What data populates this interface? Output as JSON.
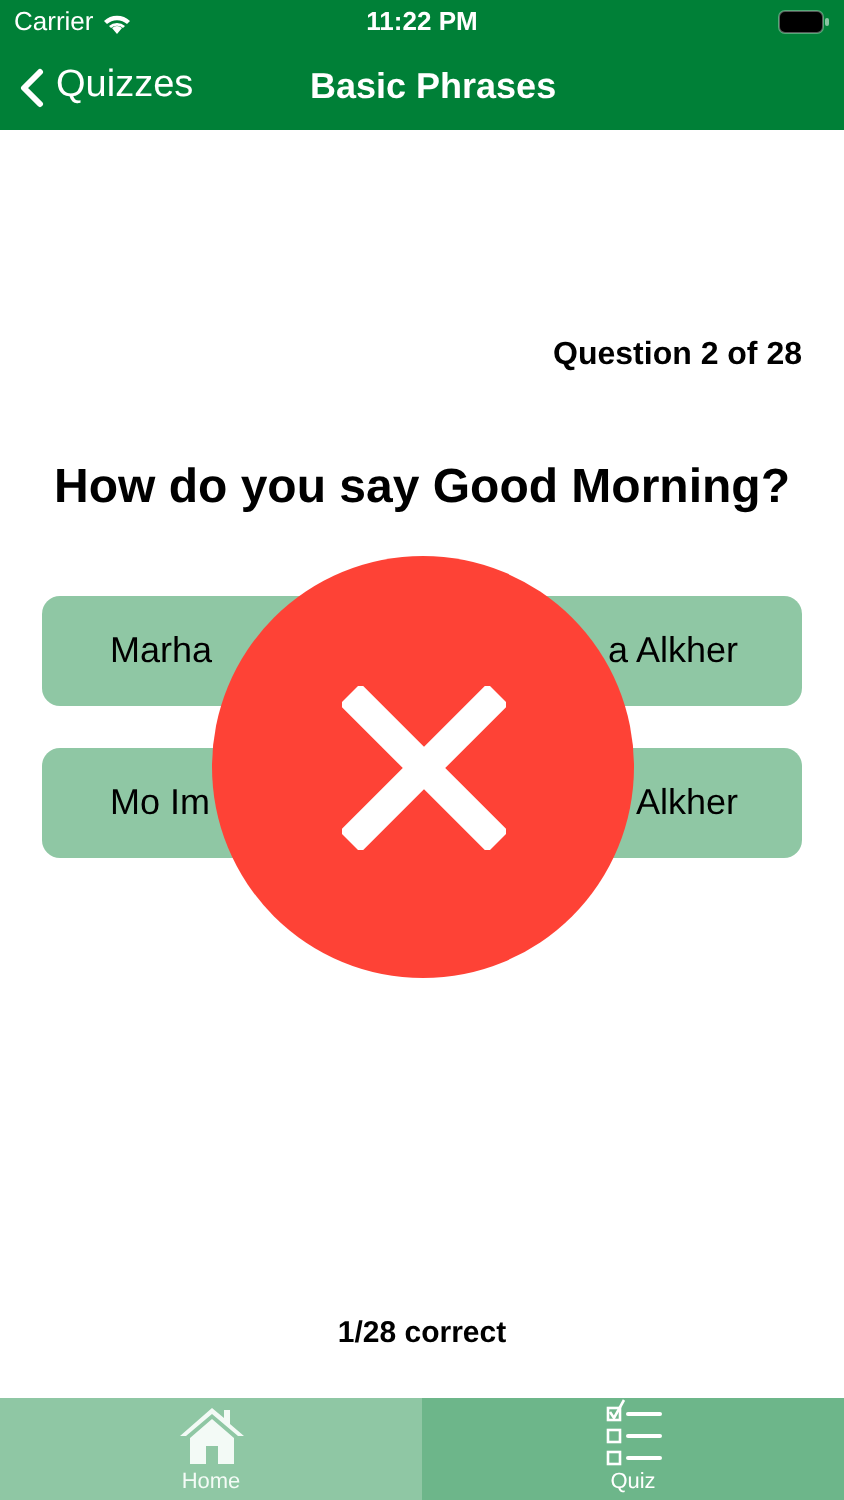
{
  "status_bar": {
    "carrier": "Carrier",
    "time": "11:22 PM"
  },
  "nav_bar": {
    "back": "Quizzes",
    "title": "Basic Phrases"
  },
  "progress": "Question 2 of 28",
  "question": "How do you say Good Morning?",
  "answers": [
    {
      "label": "Marha"
    },
    {
      "label": "a Alkher"
    },
    {
      "label": "Mo Im"
    },
    {
      "label": "Alkher"
    }
  ],
  "result_overlay": {
    "kind": "wrong"
  },
  "score": "1/28 correct",
  "tabs": [
    {
      "label": "Home",
      "selected": false,
      "kind": "home"
    },
    {
      "label": "Quiz",
      "selected": true,
      "kind": "quiz"
    }
  ]
}
